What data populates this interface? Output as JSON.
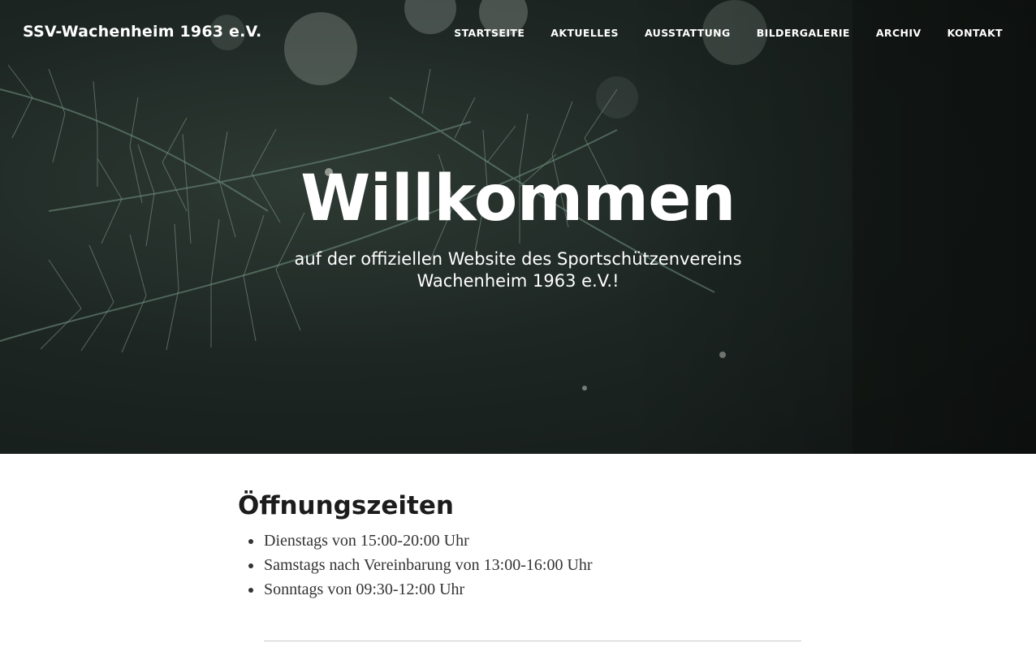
{
  "header": {
    "site_title": "SSV-Wachenheim 1963 e.V.",
    "nav": [
      {
        "label": "STARTSEITE"
      },
      {
        "label": "AKTUELLES"
      },
      {
        "label": "AUSSTATTUNG"
      },
      {
        "label": "BILDERGALERIE"
      },
      {
        "label": "ARCHIV"
      },
      {
        "label": "KONTAKT"
      }
    ]
  },
  "hero": {
    "heading": "Willkommen",
    "subtitle": "auf der offiziellen Website des Sportschützenvereins Wachenheim 1963 e.V.!"
  },
  "opening_hours": {
    "heading": "Öffnungszeiten",
    "items": [
      "Dienstags von 15:00-20:00 Uhr",
      "Samstags nach Vereinbarung von 13:00-16:00 Uhr",
      "Sonntags von 09:30-12:00 Uhr"
    ]
  },
  "colors": {
    "text_dark": "#1c1c1c",
    "text_body": "#333333",
    "hero_overlay": "#1d2623"
  }
}
